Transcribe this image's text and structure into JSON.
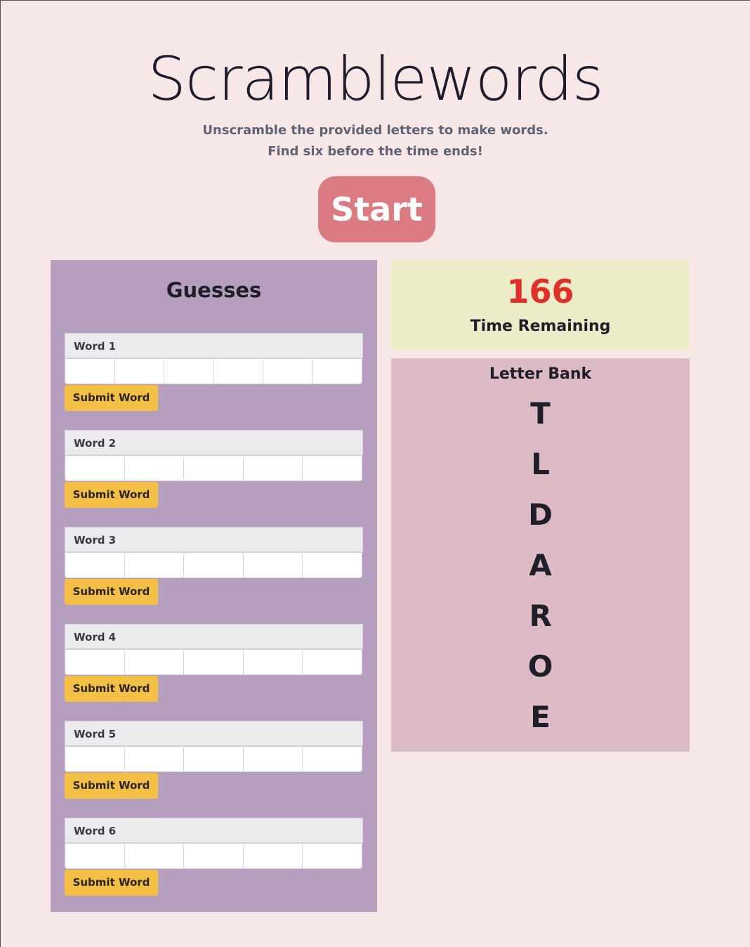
{
  "title": "Scramblewords",
  "subtitle_line1": "Unscramble the provided letters to make words.",
  "subtitle_line2": "Find six before the time ends!",
  "start_label": "Start",
  "guesses": {
    "heading": "Guesses",
    "submit_label": "Submit Word",
    "words": [
      {
        "label": "Word 1",
        "cells": 6
      },
      {
        "label": "Word 2",
        "cells": 5
      },
      {
        "label": "Word 3",
        "cells": 5
      },
      {
        "label": "Word 4",
        "cells": 5
      },
      {
        "label": "Word 5",
        "cells": 5
      },
      {
        "label": "Word 6",
        "cells": 5
      }
    ]
  },
  "timer": {
    "value": "166",
    "label": "Time Remaining"
  },
  "letter_bank": {
    "heading": "Letter Bank",
    "letters": [
      "T",
      "L",
      "D",
      "A",
      "R",
      "O",
      "E"
    ]
  }
}
